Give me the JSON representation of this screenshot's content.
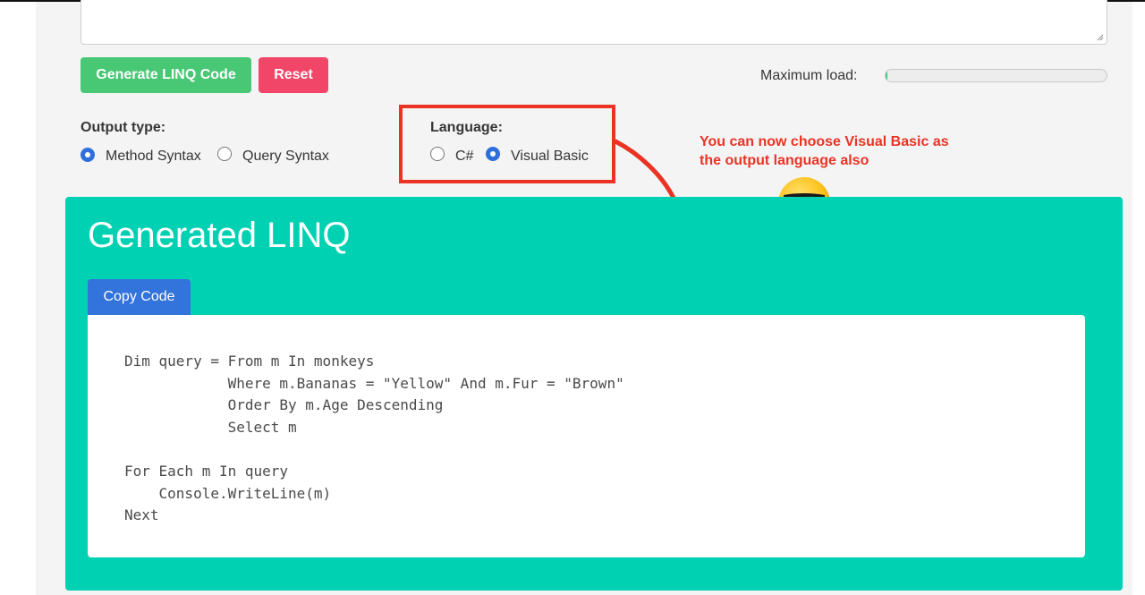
{
  "buttons": {
    "generate_label": "Generate LINQ Code",
    "reset_label": "Reset"
  },
  "load": {
    "label": "Maximum load:",
    "progress_percent": 1
  },
  "output_type": {
    "label": "Output type:",
    "options": [
      {
        "label": "Method Syntax",
        "checked": true
      },
      {
        "label": "Query Syntax",
        "checked": false
      }
    ]
  },
  "language": {
    "label": "Language:",
    "options": [
      {
        "label": "C#",
        "checked": false
      },
      {
        "label": "Visual Basic",
        "checked": true
      }
    ]
  },
  "annotation": {
    "line1": "You can now choose Visual Basic as",
    "line2": "the output language also",
    "emoji": "smiling-face-with-sunglasses-icon"
  },
  "generated": {
    "title": "Generated LINQ",
    "copy_label": "Copy Code",
    "code": "Dim query = From m In monkeys\n            Where m.Bananas = \"Yellow\" And m.Fur = \"Brown\"\n            Order By m.Age Descending\n            Select m\n\nFor Each m In query\n    Console.WriteLine(m)\nNext"
  },
  "colors": {
    "success": "#48c774",
    "danger": "#f14668",
    "primary_teal": "#00d1b2",
    "link_blue": "#3273dc",
    "annotation_red": "#ea3323"
  }
}
